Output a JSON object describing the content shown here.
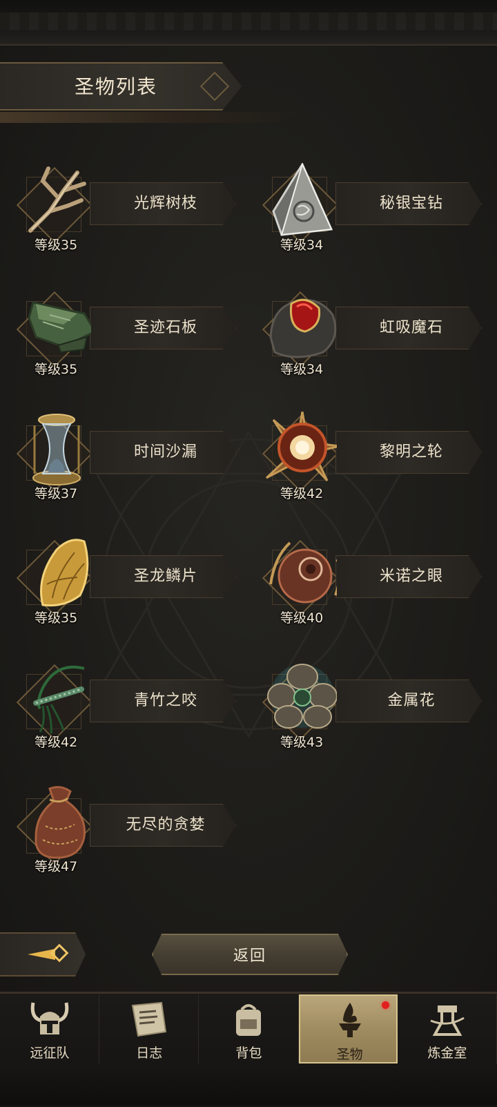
{
  "header": {
    "title": "圣物列表"
  },
  "relics": [
    {
      "name": "光辉树枝",
      "level_text": "等级35",
      "icon": "branch-icon"
    },
    {
      "name": "秘银宝钻",
      "level_text": "等级34",
      "icon": "silver-pyramid-icon"
    },
    {
      "name": "圣迹石板",
      "level_text": "等级35",
      "icon": "stone-tablet-icon"
    },
    {
      "name": "虹吸魔石",
      "level_text": "等级34",
      "icon": "red-gem-rock-icon"
    },
    {
      "name": "时间沙漏",
      "level_text": "等级37",
      "icon": "hourglass-icon"
    },
    {
      "name": "黎明之轮",
      "level_text": "等级42",
      "icon": "dawn-wheel-icon"
    },
    {
      "name": "圣龙鳞片",
      "level_text": "等级35",
      "icon": "dragon-scale-icon"
    },
    {
      "name": "米诺之眼",
      "level_text": "等级40",
      "icon": "eye-orb-icon"
    },
    {
      "name": "青竹之咬",
      "level_text": "等级42",
      "icon": "bamboo-whip-icon"
    },
    {
      "name": "金属花",
      "level_text": "等级43",
      "icon": "metal-flower-icon"
    },
    {
      "name": "无尽的贪婪",
      "level_text": "等级47",
      "icon": "coin-pouch-icon"
    }
  ],
  "actions": {
    "return_label": "返回"
  },
  "nav": {
    "items": [
      {
        "label": "远征队",
        "icon": "horned-helmet-icon",
        "active": false
      },
      {
        "label": "日志",
        "icon": "scroll-icon",
        "active": false
      },
      {
        "label": "背包",
        "icon": "backpack-icon",
        "active": false
      },
      {
        "label": "圣物",
        "icon": "brazier-icon",
        "active": true,
        "badge": true
      },
      {
        "label": "炼金室",
        "icon": "alchemy-icon",
        "active": false
      }
    ]
  },
  "colors": {
    "background": "#1c1b19",
    "gold_accent": "#6e5a3a",
    "active_tab": "#b9a67a",
    "badge_red": "#e01f1f"
  }
}
